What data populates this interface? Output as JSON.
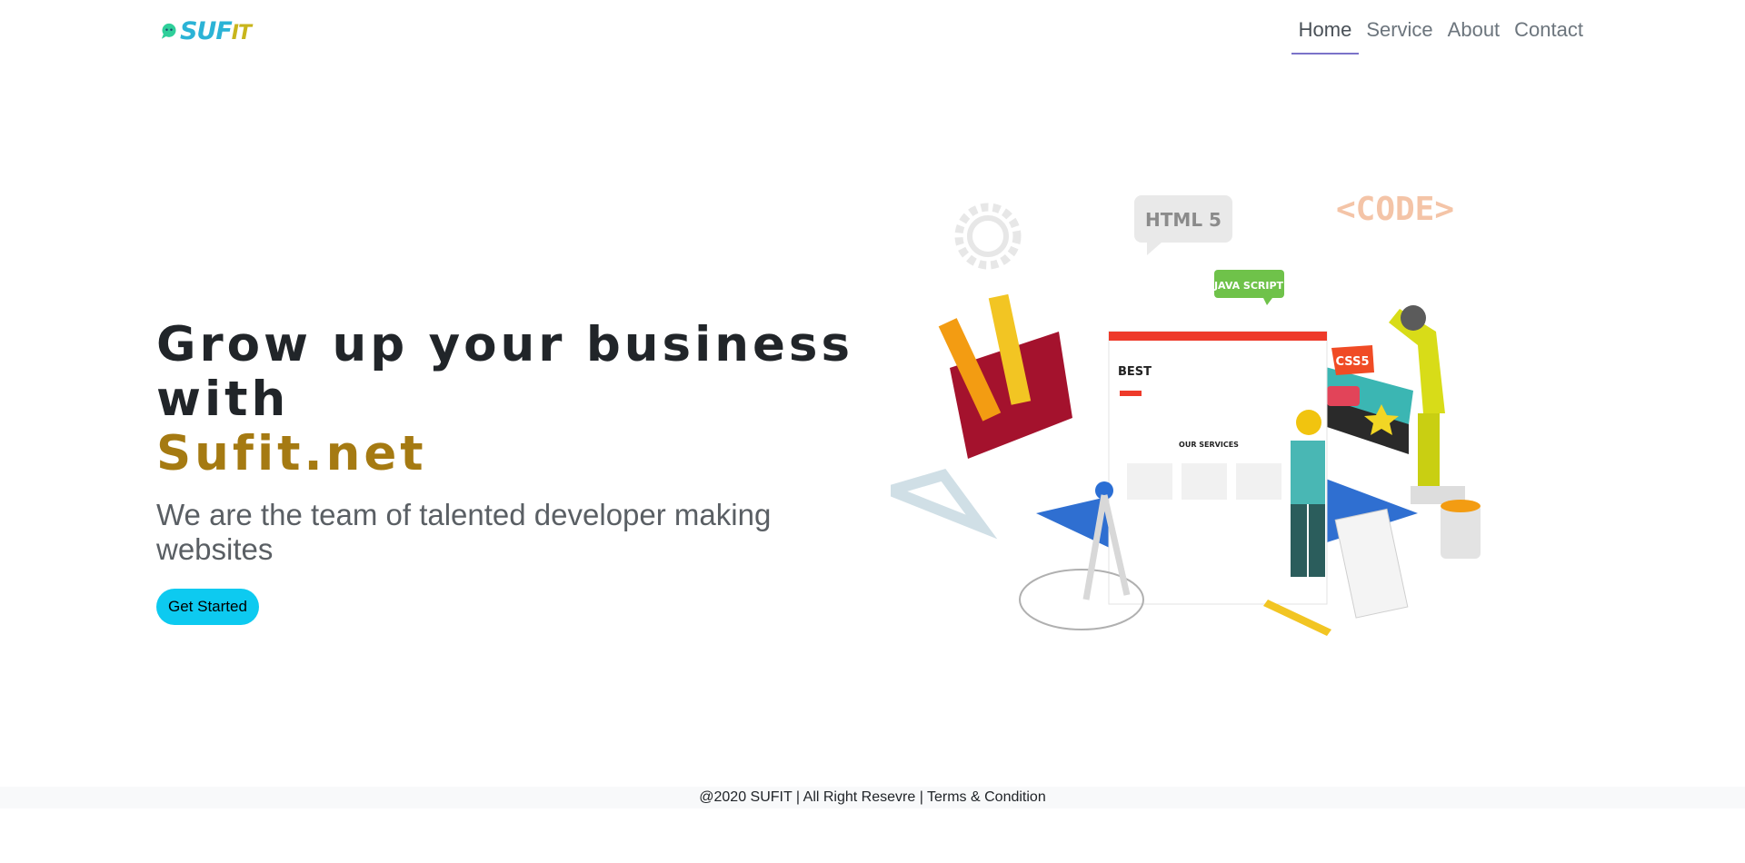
{
  "brand": {
    "part1": "SUF",
    "part2": "IT"
  },
  "nav": {
    "items": [
      {
        "label": "Home",
        "active": true
      },
      {
        "label": "Service",
        "active": false
      },
      {
        "label": "About",
        "active": false
      },
      {
        "label": "Contact",
        "active": false
      }
    ]
  },
  "hero": {
    "title_line1": "Grow up your business with",
    "title_line2": "Sufit.net",
    "subtitle": "We are the team of talented developer making websites",
    "cta_label": "Get Started"
  },
  "illustration": {
    "html_bubble": "HTML 5",
    "code_tag": "<CODE>",
    "js_bubble": "JAVA SCRIPT",
    "css_tag": "CSS5",
    "screen_heading": "BEST",
    "screen_section": "OUR SERVICES"
  },
  "footer": {
    "text": "@2020 SUFIT | All Right Resevre | Terms & Condition"
  },
  "colors": {
    "accent": "#a57a12",
    "button": "#0dcaf0",
    "nav_underline": "#7b73c9",
    "footer_bg": "#f8f9fa"
  }
}
